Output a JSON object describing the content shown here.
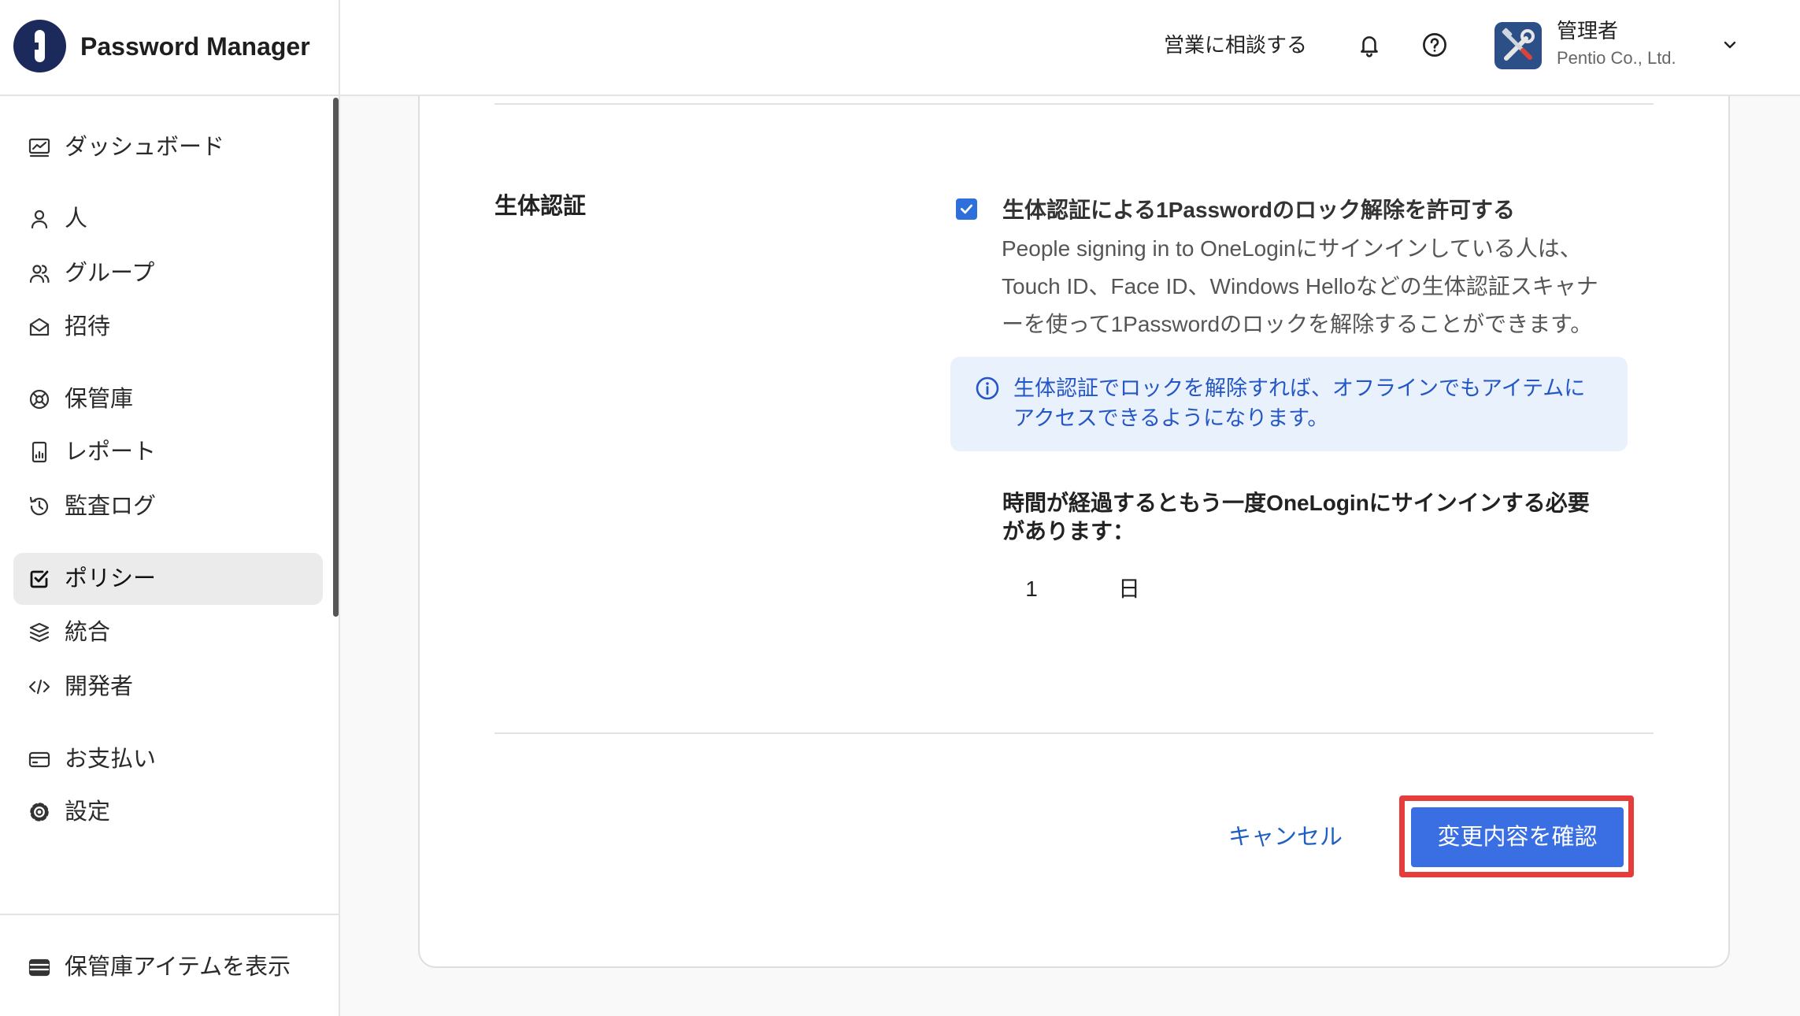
{
  "app": {
    "title": "Password Manager",
    "logo_icon": "onepassword-logo-icon"
  },
  "header": {
    "sales_link": "営業に相談する",
    "icons": {
      "notifications": "bell-icon",
      "help": "help-icon",
      "menu": "chevron-down-icon"
    },
    "user": {
      "name": "管理者",
      "org": "Pentio Co., Ltd.",
      "avatar_icon": "tools-avatar-icon"
    }
  },
  "sidebar": {
    "items": [
      {
        "label": "ダッシュボード",
        "icon": "dashboard-icon"
      },
      {
        "label": "人",
        "icon": "person-icon"
      },
      {
        "label": "グループ",
        "icon": "group-icon"
      },
      {
        "label": "招待",
        "icon": "envelope-open-icon"
      },
      {
        "label": "保管庫",
        "icon": "vault-icon"
      },
      {
        "label": "レポート",
        "icon": "report-icon"
      },
      {
        "label": "監査ログ",
        "icon": "audit-log-icon"
      },
      {
        "label": "ポリシー",
        "icon": "policy-check-icon",
        "active": true
      },
      {
        "label": "統合",
        "icon": "integration-icon"
      },
      {
        "label": "開発者",
        "icon": "code-icon"
      },
      {
        "label": "お支払い",
        "icon": "credit-card-icon"
      },
      {
        "label": "設定",
        "icon": "gear-icon"
      }
    ],
    "footer": {
      "label": "保管庫アイテムを表示",
      "icon": "vault-items-icon"
    }
  },
  "policy_section": {
    "title": "生体認証",
    "checkbox": {
      "label": "生体認証による1Passwordのロック解除を許可する",
      "checked": true
    },
    "description_lines": [
      "People signing in to OneLoginにサインインしている人は、",
      "Touch ID、Face ID、Windows Helloなどの生体認証スキャナ",
      "ーを使って1Passwordのロックを解除することができます。"
    ],
    "info_icon": "info-icon",
    "info_lines": [
      "生体認証でロックを解除すれば、オフラインでもアイテムに",
      "アクセスできるようになります。"
    ],
    "reauth": {
      "label_lines": [
        "時間が経過するともう一度OneLoginにサインインする必要",
        "があります："
      ],
      "value": "1",
      "unit": "日"
    }
  },
  "actions": {
    "cancel": "キャンセル",
    "confirm": "変更内容を確認"
  },
  "colors": {
    "brand": "#1b2a5b",
    "accent": "#3a6ee3",
    "check": "#2f6fdb",
    "link": "#1f5fc4",
    "info_bg": "#e9f1fd",
    "info_text": "#2457c5",
    "highlight": "#e53c3c"
  }
}
